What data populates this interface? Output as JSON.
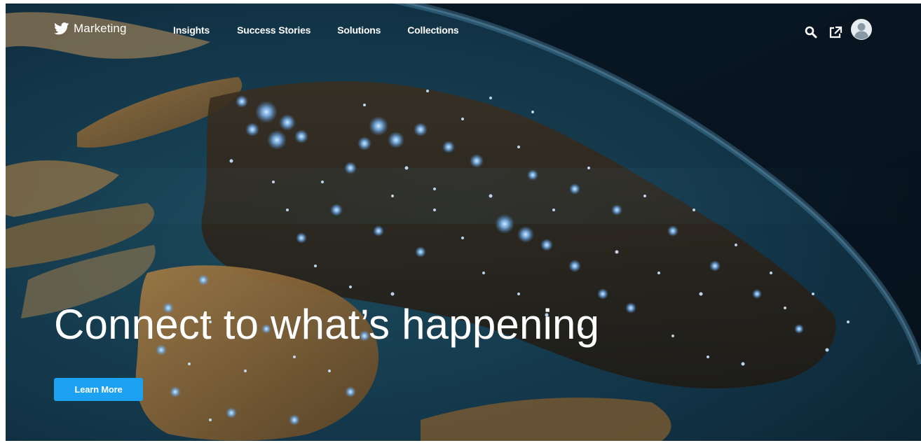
{
  "nav": {
    "brand_label": "Marketing",
    "links": [
      {
        "label": "Insights"
      },
      {
        "label": "Success Stories"
      },
      {
        "label": "Solutions"
      },
      {
        "label": "Collections"
      }
    ],
    "icons": [
      "bird-logo-icon",
      "search-icon",
      "external-link-icon",
      "user-avatar-icon"
    ]
  },
  "hero": {
    "headline": "Connect to what’s happening",
    "cta_label": "Learn More",
    "background": "earth-at-night-from-space"
  },
  "colors": {
    "accent": "#1da1f2",
    "text": "#ffffff",
    "ocean": "#0e2a3a",
    "city_lights": "#9fd4ff",
    "land": "#8a6a3a"
  }
}
